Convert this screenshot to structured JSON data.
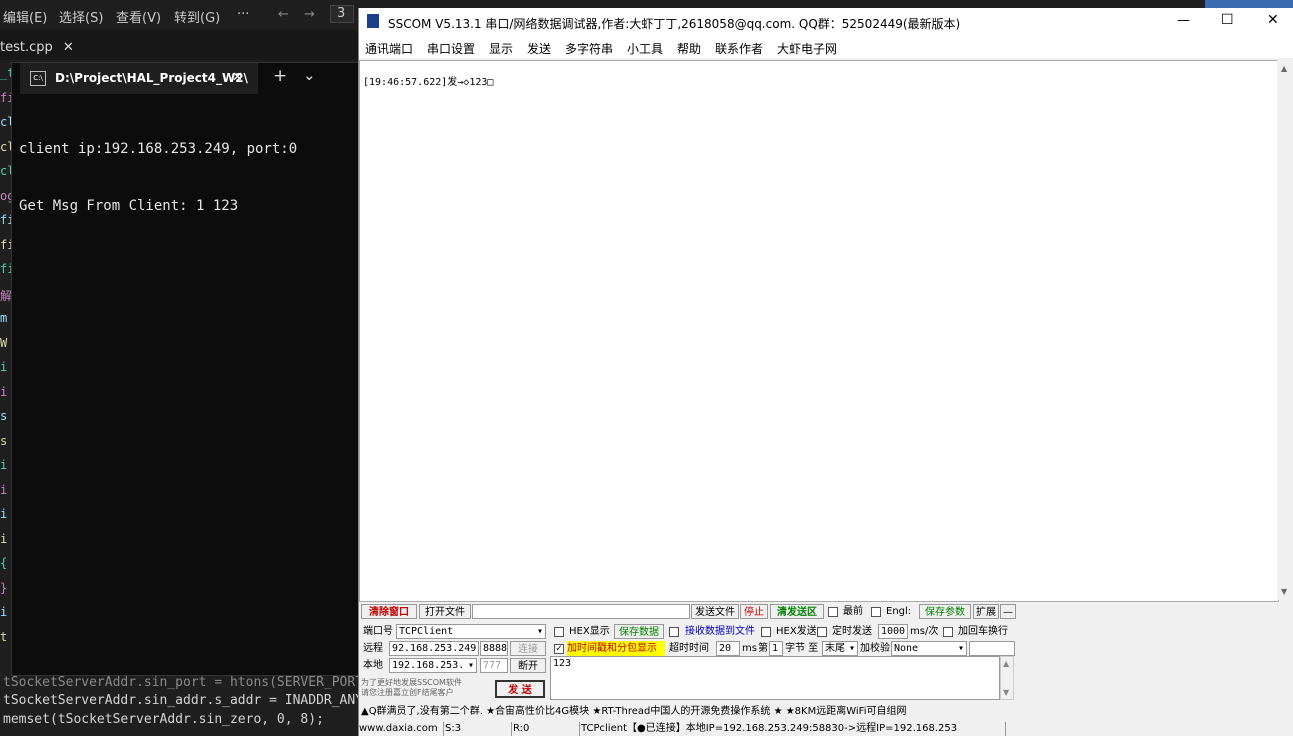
{
  "vscode": {
    "menu": [
      "编辑(E)",
      "选择(S)",
      "查看(V)",
      "转到(G)",
      "···"
    ],
    "nav_back": "←",
    "nav_forward": "→",
    "search_fragment": "3",
    "tab_label": "test.cpp",
    "tab_close": "✕",
    "gutter_fragments": [
      "_t",
      "fi",
      "cl",
      "cl",
      "cl",
      "og",
      "fi",
      "fi",
      "fi",
      "解",
      "m",
      "W",
      "i",
      "i",
      "s",
      "s",
      "i",
      "i",
      "i",
      "i",
      "{",
      "}",
      "i",
      "t"
    ],
    "code_lines": [
      "tSocketServerAddr.sin_port = htons(SERVER_PORT",
      "tSocketServerAddr.sin_addr.s_addr = INADDR_ANY",
      "memset(tSocketServerAddr.sin_zero, 0, 8);"
    ]
  },
  "terminal": {
    "tab_title": "D:\\Project\\HAL_Project4_W2\\",
    "tab_icon": "C:\\",
    "close": "✕",
    "new_tab": "+",
    "dropdown": "⌄",
    "output": [
      "client ip:192.168.253.249, port:0",
      "Get Msg From Client: 1 123"
    ]
  },
  "sscom": {
    "title": "SSCOM V5.13.1 串口/网络数据调试器,作者:大虾丁丁,2618058@qq.com. QQ群：52502449(最新版本)",
    "window_controls": {
      "minimize": "—",
      "maximize": "☐",
      "close": "✕"
    },
    "menu": [
      "通讯端口",
      "串口设置",
      "显示",
      "发送",
      "多字符串",
      "小工具",
      "帮助",
      "联系作者",
      "大虾电子网"
    ],
    "receive_text": "[19:46:57.622]发→◇123□",
    "toolbar": {
      "clear_window": "清除窗口",
      "open_file": "打开文件",
      "send_file": "发送文件",
      "stop": "停止",
      "clear_send": "清发送区",
      "topmost": "最前",
      "english": "Engl:",
      "save_params": "保存参数",
      "expand": "扩展",
      "collapse": "—"
    },
    "config": {
      "port_label": "端口号",
      "port_value": "TCPClient",
      "hex_display": "HEX显示",
      "save_data": "保存数据",
      "recv_to_file": "接收数据到文件",
      "hex_send": "HEX发送",
      "timed_send": "定时发送",
      "interval": "1000",
      "interval_unit": "ms/次",
      "add_crlf": "加回车换行",
      "remote_label": "远程",
      "remote_ip": "92.168.253.249",
      "remote_port": "8888",
      "connect": "连接",
      "timestamp_label": "加时间戳和分包显示",
      "timeout_label": "超时时间",
      "timeout_value": "20",
      "timeout_unit": "ms",
      "nth_label": "第",
      "nth_value": "1",
      "byte_label": "字节 至",
      "end_value": "末尾",
      "checksum_label": "加校验",
      "checksum_value": "None",
      "local_label": "本地",
      "local_ip": "192.168.253.",
      "local_port": "777",
      "disconnect": "断开",
      "send_text": "123",
      "send_button": "发 送",
      "promo": "为了更好地发展SSCOM软件\n请您注册嘉立创F结尾客户"
    },
    "ticker": "▲Q群满员了,没有第二个群.   ★合宙高性价比4G模块   ★RT-Thread中国人的开源免费操作系统    ★  ★8KM远距离WiFi可自组网",
    "status": {
      "site": "www.daxia.com",
      "sent": "S:3",
      "received": "R:0",
      "connection": "TCPclient【●已连接】本地IP=192.168.253.249:58830->远程IP=192.168.253"
    },
    "colors": {
      "accent_red": "#c00000",
      "accent_green": "#008000",
      "highlight_yellow": "#ffff00",
      "link_blue": "#0000c0"
    }
  }
}
